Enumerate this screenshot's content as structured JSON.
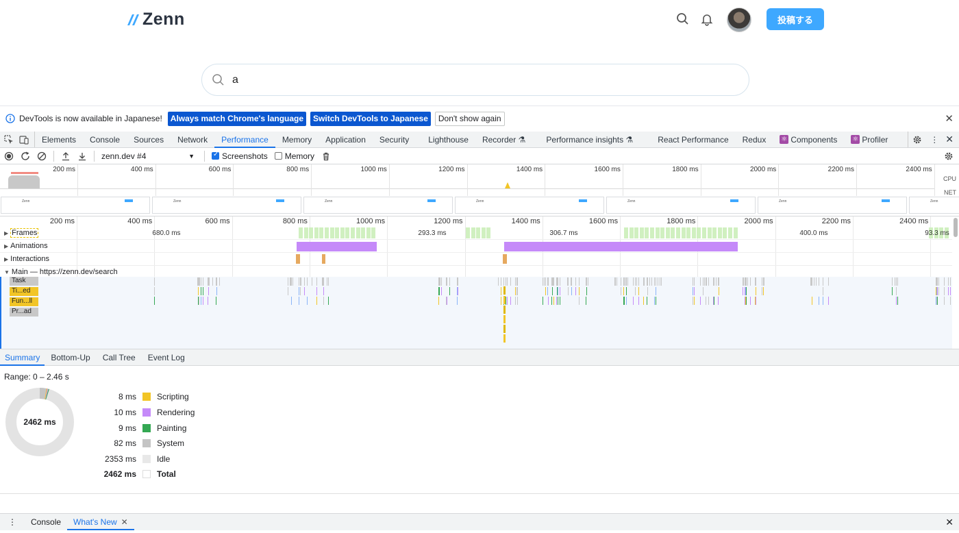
{
  "site": {
    "logo_text": "Zenn",
    "post_button": "投稿する",
    "search_query": "a"
  },
  "infobar": {
    "message": "DevTools is now available in Japanese!",
    "btn_match": "Always match Chrome's language",
    "btn_switch": "Switch DevTools to Japanese",
    "btn_dismiss": "Don't show again"
  },
  "tabs": [
    "Elements",
    "Console",
    "Sources",
    "Network",
    "Performance",
    "Memory",
    "Application",
    "Security",
    "Lighthouse",
    "Recorder",
    "Performance insights",
    "React Performance",
    "Redux",
    "Components",
    "Profiler"
  ],
  "active_tab": "Performance",
  "perf_toolbar": {
    "recording": "zenn.dev #4",
    "screenshots_label": "Screenshots",
    "memory_label": "Memory"
  },
  "overview": {
    "ticks": [
      "200 ms",
      "400 ms",
      "600 ms",
      "800 ms",
      "1000 ms",
      "1200 ms",
      "1400 ms",
      "1600 ms",
      "1800 ms",
      "2000 ms",
      "2200 ms",
      "2400 ms"
    ],
    "cpu_label": "CPU",
    "net_label": "NET",
    "shot_logo": "Zenn"
  },
  "timeline": {
    "ticks": [
      "200 ms",
      "400 ms",
      "600 ms",
      "800 ms",
      "1000 ms",
      "1200 ms",
      "1400 ms",
      "1600 ms",
      "1800 ms",
      "2000 ms",
      "2200 ms",
      "2400 ms"
    ],
    "frames_label": "Frames",
    "frame_durations": [
      "680.0 ms",
      "293.3 ms",
      "306.7 ms",
      "400.0 ms",
      "93.3 ms"
    ],
    "animations_label": "Animations",
    "interactions_label": "Interactions",
    "main_label": "Main — https://zenn.dev/search",
    "legend": [
      "Task",
      "Ti...ed",
      "Fun...ll",
      "Pr...ad"
    ]
  },
  "bottom_tabs": [
    "Summary",
    "Bottom-Up",
    "Call Tree",
    "Event Log"
  ],
  "summary": {
    "range": "Range: 0 – 2.46 s",
    "total_center": "2462 ms",
    "rows": [
      {
        "value": "8 ms",
        "label": "Scripting",
        "color": "#f2c526"
      },
      {
        "value": "10 ms",
        "label": "Rendering",
        "color": "#c58af9"
      },
      {
        "value": "9 ms",
        "label": "Painting",
        "color": "#34a853"
      },
      {
        "value": "82 ms",
        "label": "System",
        "color": "#c4c4c4"
      },
      {
        "value": "2353 ms",
        "label": "Idle",
        "color": "#e8e8e8"
      },
      {
        "value": "2462 ms",
        "label": "Total",
        "color": "#ffffff"
      }
    ]
  },
  "drawer": {
    "console": "Console",
    "whats_new": "What's New"
  }
}
